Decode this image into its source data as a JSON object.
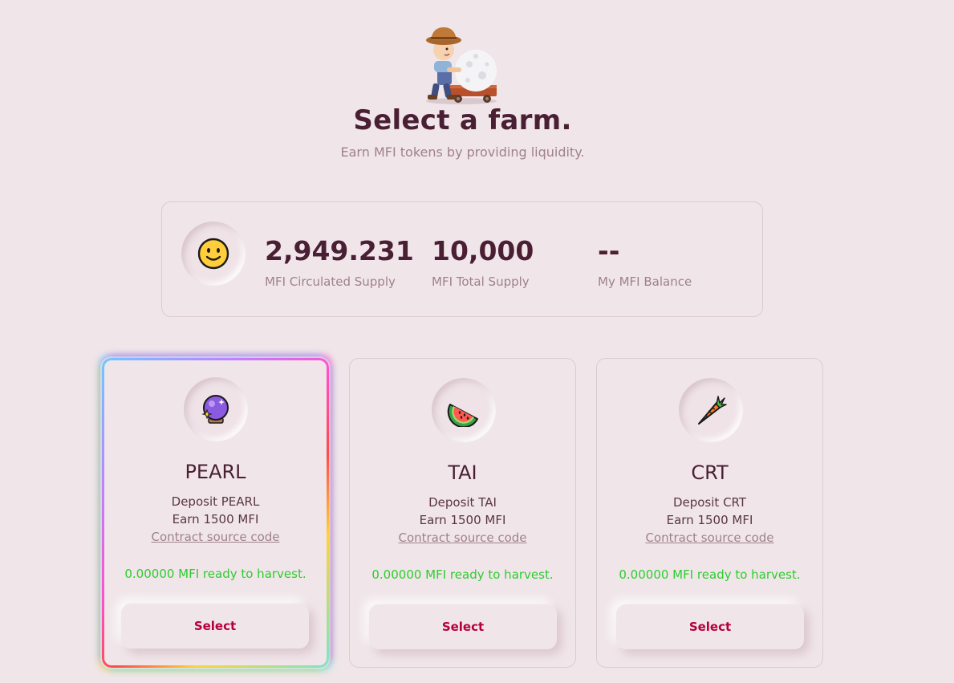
{
  "header": {
    "title": "Select a farm.",
    "subtitle": "Earn MFI tokens by providing liquidity."
  },
  "stats": {
    "icon": "smiley-face-icon",
    "circulated": {
      "value": "2,949.231",
      "label": "MFI Circulated Supply"
    },
    "total": {
      "value": "10,000",
      "label": "MFI Total Supply"
    },
    "balance": {
      "value": "--",
      "label": "My MFI Balance"
    }
  },
  "farms": [
    {
      "name": "PEARL",
      "icon": "crystal-ball-icon",
      "deposit": "Deposit PEARL",
      "earn": "Earn 1500 MFI",
      "contract": "Contract source code",
      "harvest": "0.00000 MFI ready to harvest.",
      "button": "Select",
      "selected": true
    },
    {
      "name": "TAI",
      "icon": "watermelon-icon",
      "deposit": "Deposit TAI",
      "earn": "Earn 1500 MFI",
      "contract": "Contract source code",
      "harvest": "0.00000 MFI ready to harvest.",
      "button": "Select",
      "selected": false
    },
    {
      "name": "CRT",
      "icon": "carrot-icon",
      "deposit": "Deposit CRT",
      "earn": "Earn 1500 MFI",
      "contract": "Contract source code",
      "harvest": "0.00000 MFI ready to harvest.",
      "button": "Select",
      "selected": false
    }
  ],
  "colors": {
    "background": "#f0e6e9",
    "title": "#4a1f33",
    "muted": "#a0808d",
    "harvest": "#2ecc2e",
    "button_text": "#b5003c"
  }
}
